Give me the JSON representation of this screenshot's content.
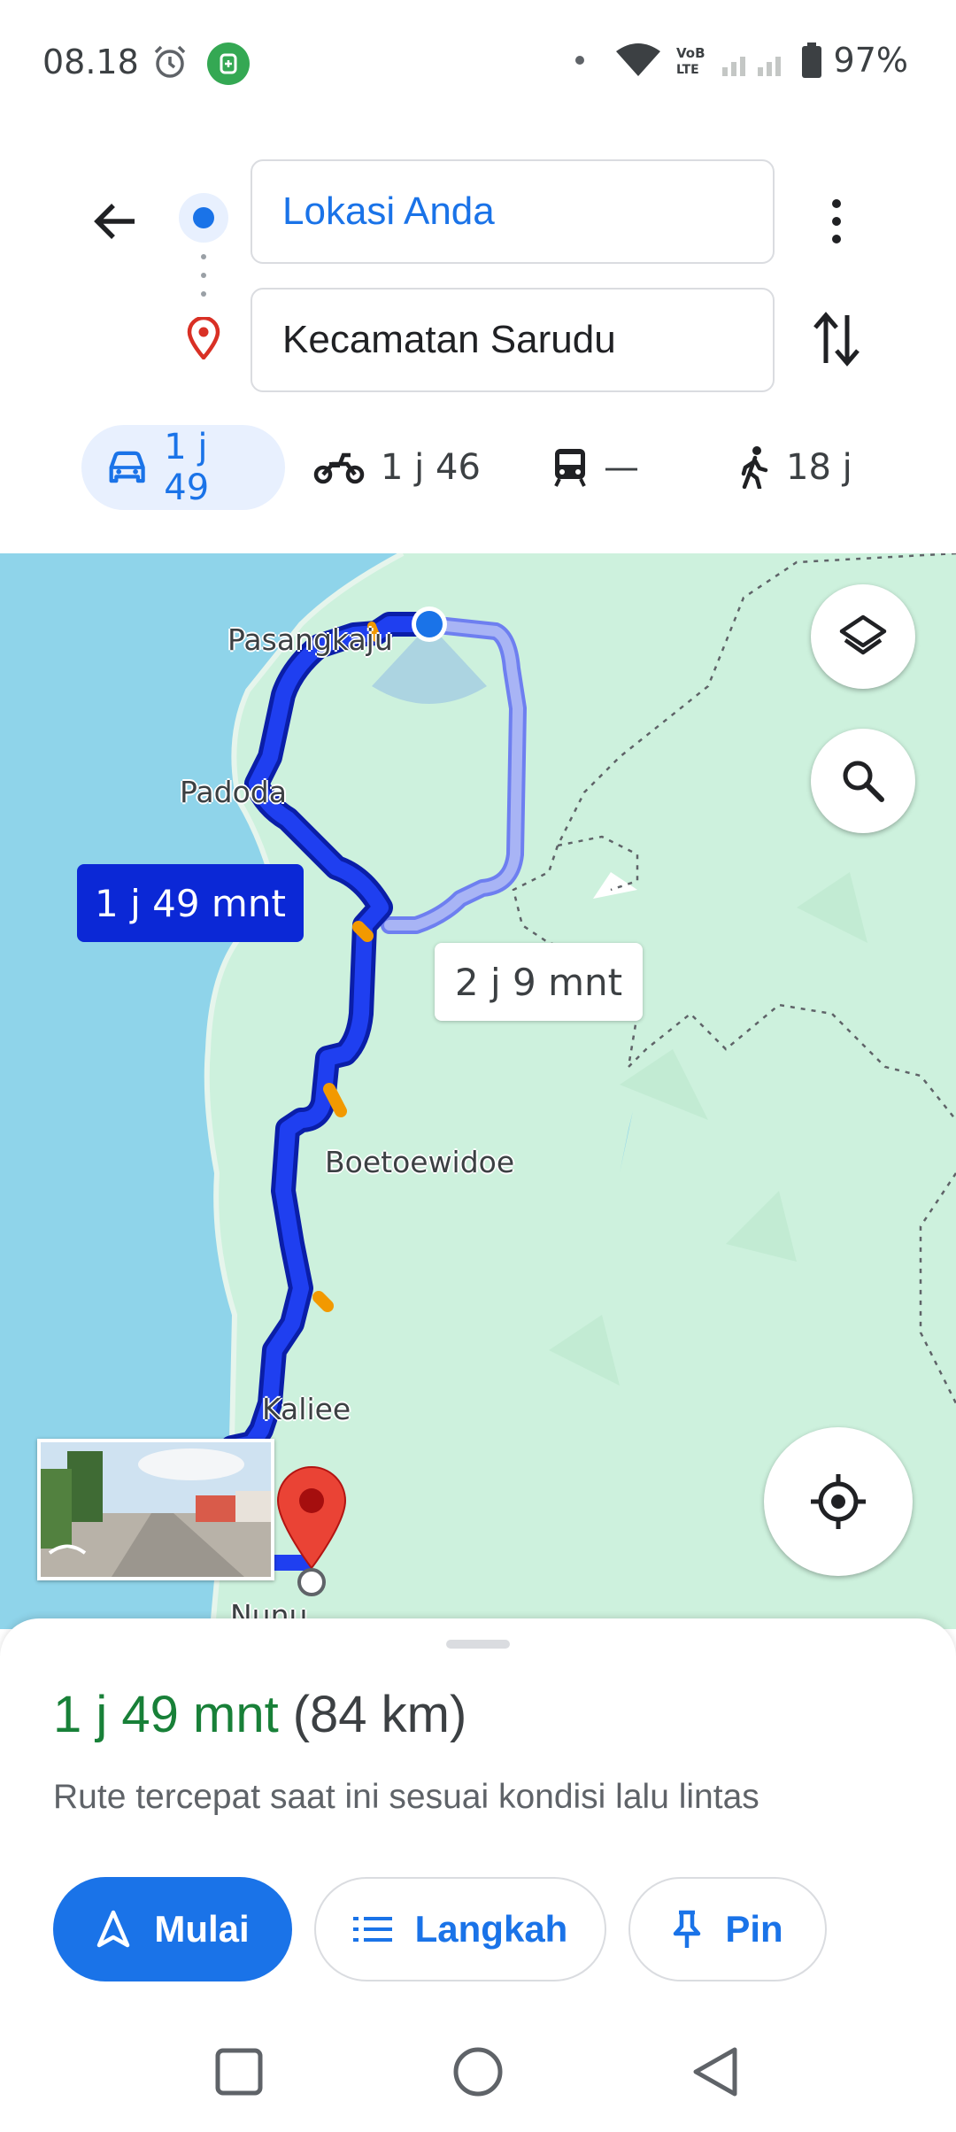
{
  "status_bar": {
    "time": "08.18",
    "battery": "97%",
    "icons": [
      "alarm-icon",
      "app-notification-icon",
      "dot-icon",
      "wifi-icon",
      "volte-icon",
      "signal-icon",
      "battery-icon"
    ]
  },
  "directions": {
    "origin": "Lokasi Anda",
    "destination": "Kecamatan Sarudu",
    "icons": [
      "back-arrow-icon",
      "more-vert-icon",
      "swap-icon",
      "origin-dot-icon",
      "destination-pin-icon"
    ],
    "modes": [
      {
        "id": "drive",
        "icon": "car-icon",
        "label": "1 j 49",
        "active": true
      },
      {
        "id": "motorcycle",
        "icon": "motorcycle-icon",
        "label": "1 j 46",
        "active": false
      },
      {
        "id": "transit",
        "icon": "train-icon",
        "label": "—",
        "active": false
      },
      {
        "id": "walk",
        "icon": "walk-icon",
        "label": "18 j",
        "active": false
      }
    ]
  },
  "map": {
    "places": [
      "Pasangkaju",
      "Padoda",
      "Boetoewidoe",
      "Kaliee",
      "Nunu"
    ],
    "route_main_label": "1 j 49 mnt",
    "route_alt_label": "2 j 9 mnt",
    "route_color": "#0b28d6",
    "alt_route_color": "#a8b4f5",
    "sea_color": "#8fd4ea",
    "land_color": "#cdf1dd",
    "buttons": [
      "layers-icon",
      "search-icon",
      "my-location-icon"
    ]
  },
  "sheet": {
    "duration": "1 j 49 mnt",
    "distance": "(84 km)",
    "description": "Rute tercepat saat ini sesuai kondisi lalu lintas",
    "buttons": {
      "start": "Mulai",
      "steps": "Langkah",
      "pin": "Pin"
    },
    "accent": "#1a73e8",
    "duration_color": "#188038"
  },
  "nav_bar": [
    "recents-icon",
    "home-icon",
    "back-icon"
  ]
}
